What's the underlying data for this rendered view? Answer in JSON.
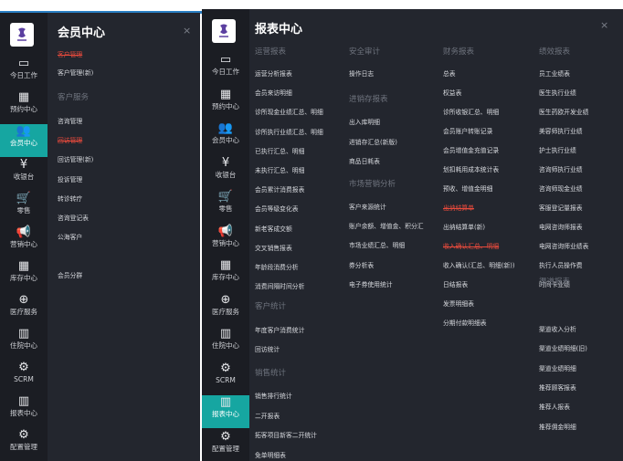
{
  "nav_items": [
    {
      "icon": "laptop-icon",
      "glyph": "▭",
      "label": "今日工作"
    },
    {
      "icon": "calendar-icon",
      "glyph": "▦",
      "label": "预约中心"
    },
    {
      "icon": "users-icon",
      "glyph": "👥",
      "label": "会员中心"
    },
    {
      "icon": "yen-icon",
      "glyph": "¥",
      "label": "收银台"
    },
    {
      "icon": "cart-icon",
      "glyph": "🛒",
      "label": "零售"
    },
    {
      "icon": "megaphone-icon",
      "glyph": "📢",
      "label": "营销中心"
    },
    {
      "icon": "grid-icon",
      "glyph": "▦",
      "label": "库存中心"
    },
    {
      "icon": "medkit-icon",
      "glyph": "⊕",
      "label": "医疗服务"
    },
    {
      "icon": "building-icon",
      "glyph": "▥",
      "label": "住院中心"
    },
    {
      "icon": "cogs-icon",
      "glyph": "⚙",
      "label": "SCRM"
    },
    {
      "icon": "bar-chart-icon",
      "glyph": "▥",
      "label": "报表中心"
    },
    {
      "icon": "gear-icon",
      "glyph": "⚙",
      "label": "配置管理"
    }
  ],
  "member_panel": {
    "title": "会员中心",
    "close": "×",
    "item_customer_manage_del": "客户管理",
    "item_customer_manage_new": "客户管理(新)",
    "section_service": "客户服务",
    "item_consult": "咨询管理",
    "item_followup_del": "回访管理",
    "item_followup_new": "回访管理(新)",
    "item_complaint": "投诉管理",
    "item_transfer": "转诊转疗",
    "item_consult_register": "咨询登记表",
    "item_public": "公海客户",
    "item_group": "会员分群"
  },
  "report_panel": {
    "title": "报表中心",
    "close": "×",
    "col1": {
      "heading": "运营报表",
      "items": [
        "运营分析报表",
        "会员来访明细",
        "诊所现金业绩汇总、明细",
        "诊所执行业绩汇总、明细",
        "已执行汇总、明细",
        "未执行汇总、明细",
        "会员累计消费报表",
        "会员等级变化表",
        "新老客成交额",
        "交叉销售报表",
        "年龄段消费分析",
        "消费间隔时间分析"
      ],
      "heading2": "客户统计",
      "items2": [
        "年度客户消费统计",
        "回访统计"
      ],
      "heading3": "销售统计",
      "items3": [
        "销售排行统计",
        "二开报表",
        "拓客项目新客二开统计",
        "免单明细表"
      ]
    },
    "col2": {
      "heading": "安全审计",
      "item_log": "操作日志",
      "heading2": "进销存报表",
      "items2": [
        "出入库明细",
        "进销存汇总(新版)",
        "商品日耗表"
      ],
      "heading3": "市场营销分析",
      "items3": [
        "客户来源统计",
        "账户余额、增值金、积分汇",
        "市场业绩汇总、明细",
        "券分析表",
        "电子券使用统计"
      ]
    },
    "col3": {
      "heading": "财务报表",
      "items_a": [
        "总表",
        "权益表",
        "诊所收银汇总、明细",
        "会员账户转账记录",
        "会员增值金充值记录",
        "划扣耗用成本统计表",
        "预收、增值金明细"
      ],
      "item_del1": "出纳结算单",
      "item_new1": "出纳结算单(新)",
      "item_del2": "收入确认汇总、明细",
      "items_b": [
        "收入确认(汇总、明细(新))",
        "日结报表",
        "发票明细表",
        "分期付款明细表"
      ]
    },
    "col4": {
      "heading": "绩效报表",
      "items": [
        "员工业绩表",
        "医生执行业绩",
        "医生药欧开发业绩",
        "美容师执行业绩",
        "护士执行业绩",
        "咨询师执行业绩",
        "咨询师现金业绩",
        "客服登记量报表",
        "电网咨询师报表",
        "电网咨询师业绩表",
        "执行人员操作费",
        "时间卡业绩"
      ],
      "heading2": "渠道报表",
      "items2": [
        "渠道收入分析",
        "渠道业绩明细(旧)",
        "渠道业绩明细",
        "推荐顾客报表",
        "推荐人报表",
        "推荐佣金明细"
      ]
    }
  },
  "colors": {
    "accent": "#16a6a1",
    "panel": "#23262e",
    "sidebar": "#1b1d23",
    "strike": "#e84a3c"
  }
}
